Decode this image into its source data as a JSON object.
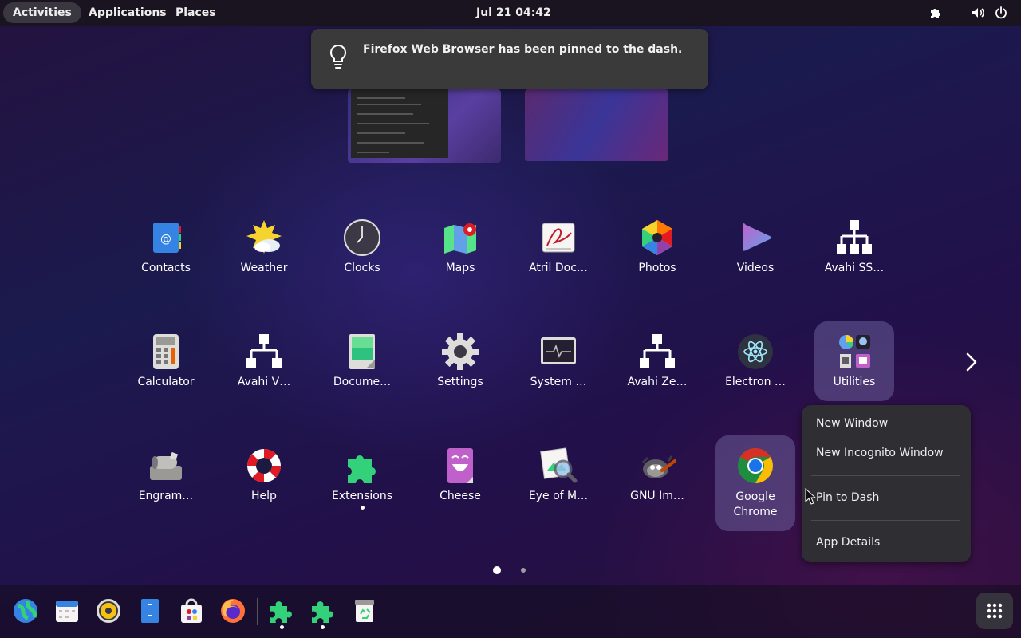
{
  "topbar": {
    "activities": "Activities",
    "applications": "Applications",
    "places": "Places",
    "clock": "Jul 21  04:42"
  },
  "notification": {
    "text": "Firefox Web Browser has been pinned to the dash.",
    "icon": "lightbulb-icon"
  },
  "apps": {
    "row1": [
      "Contacts",
      "Weather",
      "Clocks",
      "Maps",
      "Atril Doc…",
      "Photos",
      "Videos",
      "Avahi SS…"
    ],
    "row2": [
      "Calculator",
      "Avahi V…",
      "Docume…",
      "Settings",
      "System …",
      "Avahi Ze…",
      "Electron …",
      "Utilities"
    ],
    "row3": [
      "Engram…",
      "Help",
      "Extensions",
      "Cheese",
      "Eye of M…",
      "GNU Im…",
      "Google Chrome"
    ]
  },
  "context_menu": {
    "items": [
      "New Window",
      "New Incognito Window",
      "Pin to Dash",
      "App Details"
    ]
  },
  "pages": {
    "current": 1,
    "total": 2
  },
  "dash": {
    "apps": [
      "globe-icon",
      "calendar-icon",
      "rhythmbox-icon",
      "files-icon",
      "software-store-icon",
      "firefox-icon"
    ],
    "running": [
      "extensions-icon",
      "extensions-icon",
      "trash-icon"
    ]
  },
  "colors": {
    "accent_green": "#33d17a",
    "menu_bg": "#2f2f33",
    "notification_bg": "#3a3a3a"
  }
}
